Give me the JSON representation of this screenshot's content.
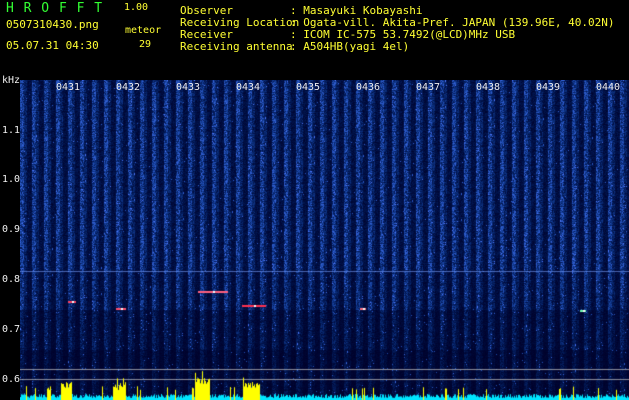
{
  "header": {
    "title": "H R O F F T",
    "version": "1.00",
    "filename": "0507310430.png",
    "meteor_label": "meteor",
    "date_time": "05.07.31 04:30",
    "meteor_count": "29"
  },
  "info": [
    {
      "key": "Observer",
      "value": ": Masayuki Kobayashi"
    },
    {
      "key": "Receiving Location",
      "value": ": Ogata-vill. Akita-Pref. JAPAN (139.96E, 40.02N)"
    },
    {
      "key": "Receiver",
      "value": ": ICOM IC-575 53.7492(@LCD)MHz USB"
    },
    {
      "key": "Receiving antenna",
      "value": ": A504HB(yagi 4el)"
    }
  ],
  "axis": {
    "unit": "kHz",
    "y_labels": [
      "1.1",
      "1.0",
      "0.9",
      "0.8",
      "0.7",
      "0.6"
    ],
    "x_labels": [
      "0431",
      "0432",
      "0433",
      "0434",
      "0435",
      "0436",
      "0437",
      "0438",
      "0439",
      "0440"
    ]
  },
  "colors": {
    "text_yellow": "#ffff33",
    "text_green": "#33ff33",
    "spectrogram_base": "#001a66",
    "activity_trace": "#ffff00",
    "noise_trace": "#00e5ff"
  }
}
